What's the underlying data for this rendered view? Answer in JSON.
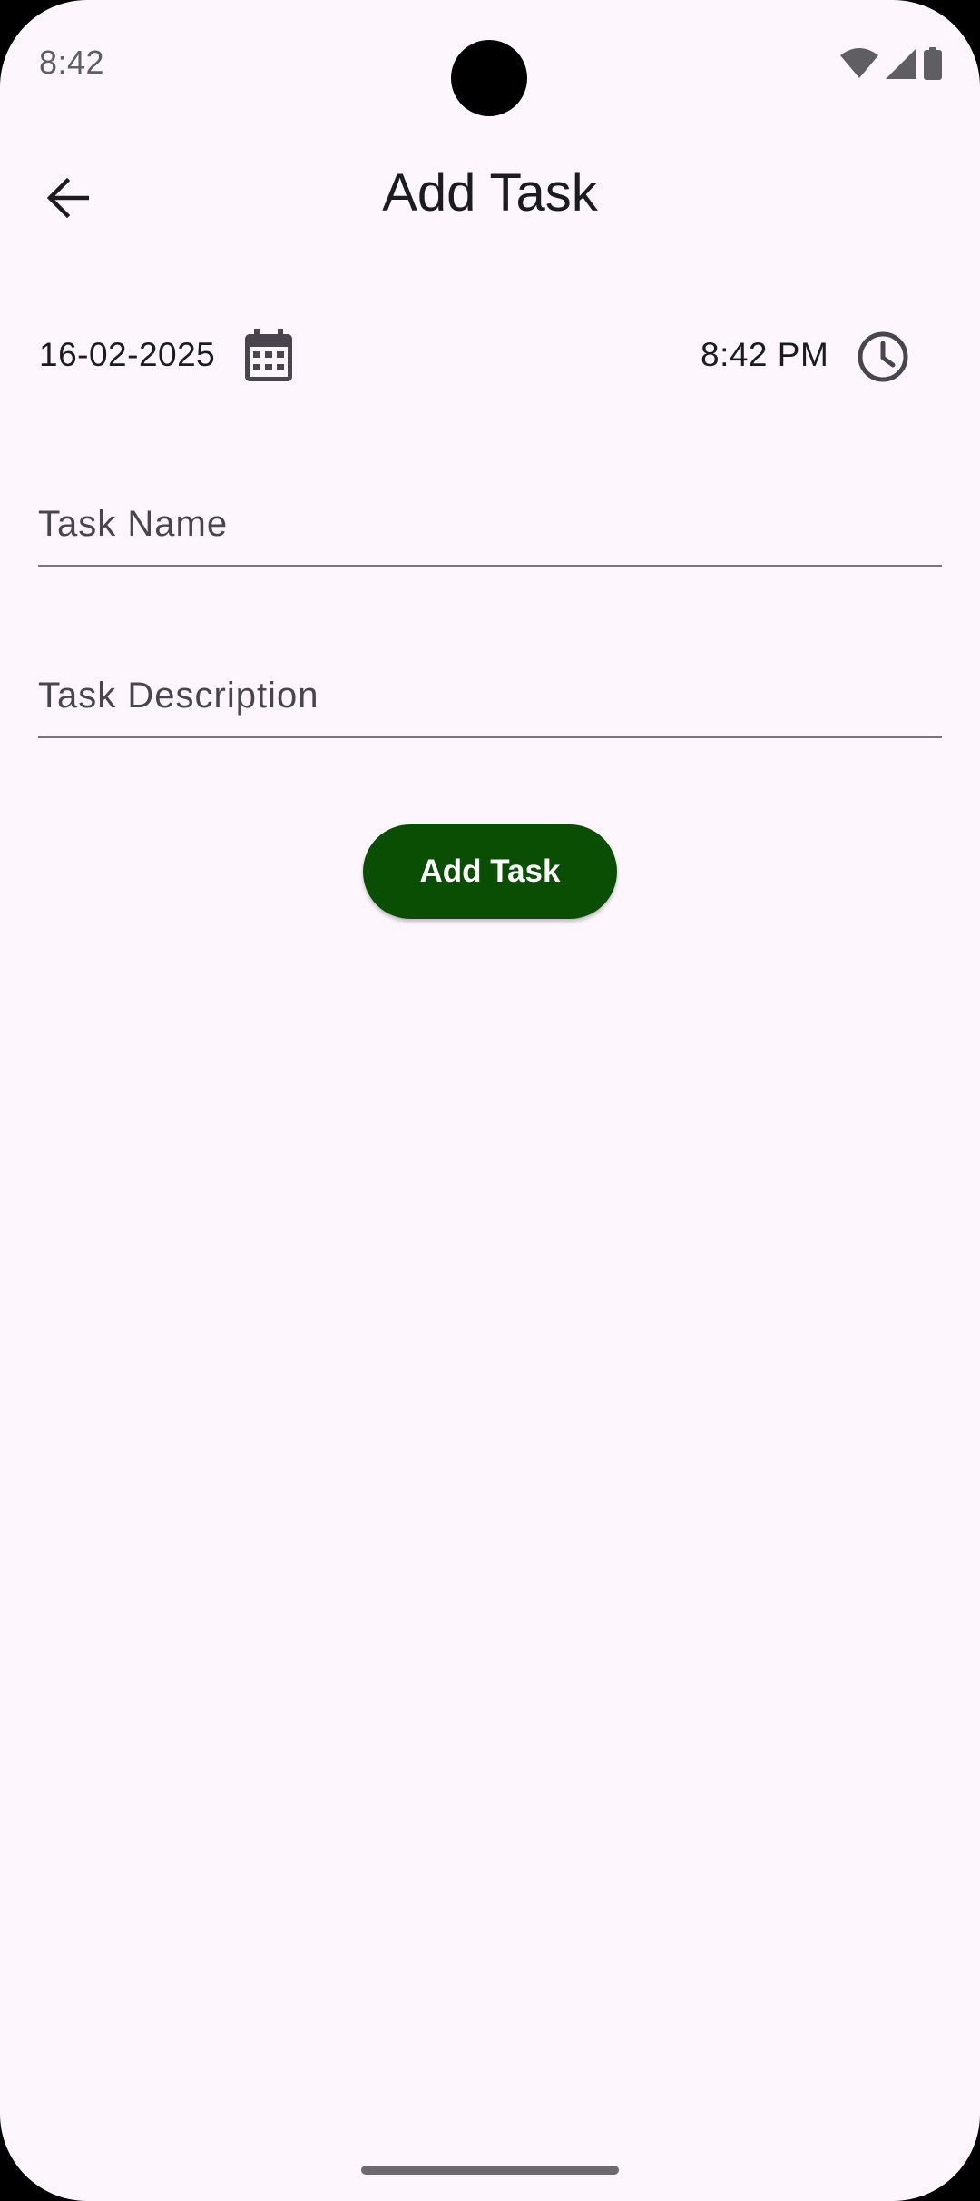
{
  "status_bar": {
    "time": "8:42"
  },
  "app_bar": {
    "back_icon": "arrow-back-icon",
    "title": "Add Task"
  },
  "schedule": {
    "date": "16-02-2025",
    "date_icon": "calendar-icon",
    "time": "8:42 PM",
    "time_icon": "clock-icon"
  },
  "form": {
    "task_name": {
      "value": "",
      "placeholder": "Task Name"
    },
    "task_description": {
      "value": "",
      "placeholder": "Task Description"
    },
    "submit_label": "Add Task"
  },
  "colors": {
    "background": "#FDF7FD",
    "primary_button": "#0A4E04",
    "text": "#1C1B1F",
    "divider": "#79747E"
  }
}
